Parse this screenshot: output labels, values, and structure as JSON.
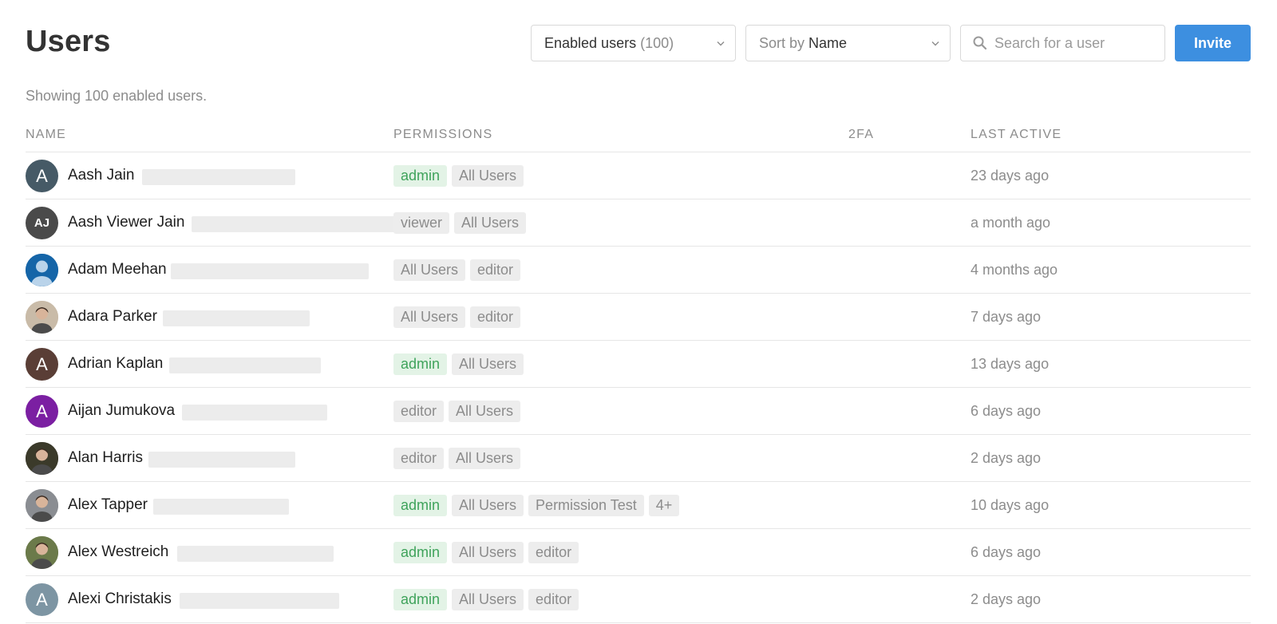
{
  "header": {
    "title": "Users",
    "filter": {
      "label": "Enabled users",
      "count": "(100)"
    },
    "sort": {
      "prefix": "Sort by",
      "value": "Name"
    },
    "search": {
      "placeholder": "Search for a user"
    },
    "invite_label": "Invite"
  },
  "summary": "Showing 100 enabled users.",
  "table": {
    "columns": {
      "name": "NAME",
      "permissions": "PERMISSIONS",
      "twofa": "2FA",
      "last_active": "LAST ACTIVE"
    },
    "rows": [
      {
        "name": "Aash Jain",
        "avatar": {
          "type": "initials",
          "text": "A",
          "color": "#465a66"
        },
        "permissions": [
          "admin",
          "All Users"
        ],
        "last_active": "23 days ago"
      },
      {
        "name": "Aash Viewer Jain",
        "avatar": {
          "type": "initials",
          "text": "AJ",
          "color": "#4a4a4a"
        },
        "permissions": [
          "viewer",
          "All Users"
        ],
        "last_active": "a month ago"
      },
      {
        "name": "Adam Meehan",
        "avatar": {
          "type": "photo",
          "icon": "default-person-avatar",
          "color": "#1565a8"
        },
        "permissions": [
          "All Users",
          "editor"
        ],
        "last_active": "4 months ago"
      },
      {
        "name": "Adara Parker",
        "avatar": {
          "type": "photo",
          "icon": "person-photo-avatar",
          "color": "#c9bba8"
        },
        "permissions": [
          "All Users",
          "editor"
        ],
        "last_active": "7 days ago"
      },
      {
        "name": "Adrian Kaplan",
        "avatar": {
          "type": "initials",
          "text": "A",
          "color": "#5a3e36"
        },
        "permissions": [
          "admin",
          "All Users"
        ],
        "last_active": "13 days ago"
      },
      {
        "name": "Aijan Jumukova",
        "avatar": {
          "type": "initials",
          "text": "A",
          "color": "#7b1fa2"
        },
        "permissions": [
          "editor",
          "All Users"
        ],
        "last_active": "6 days ago"
      },
      {
        "name": "Alan Harris",
        "avatar": {
          "type": "photo",
          "icon": "person-photo-avatar",
          "color": "#3b3a2a"
        },
        "permissions": [
          "editor",
          "All Users"
        ],
        "last_active": "2 days ago"
      },
      {
        "name": "Alex Tapper",
        "avatar": {
          "type": "photo",
          "icon": "person-photo-avatar",
          "color": "#8a8d92"
        },
        "permissions": [
          "admin",
          "All Users",
          "Permission Test",
          "4+"
        ],
        "last_active": "10 days ago"
      },
      {
        "name": "Alex Westreich",
        "avatar": {
          "type": "photo",
          "icon": "person-photo-avatar",
          "color": "#6b7a4a"
        },
        "permissions": [
          "admin",
          "All Users",
          "editor"
        ],
        "last_active": "6 days ago"
      },
      {
        "name": "Alexi Christakis",
        "avatar": {
          "type": "initials",
          "text": "A",
          "color": "#7d95a3"
        },
        "permissions": [
          "admin",
          "All Users",
          "editor"
        ],
        "last_active": "2 days ago"
      }
    ]
  }
}
